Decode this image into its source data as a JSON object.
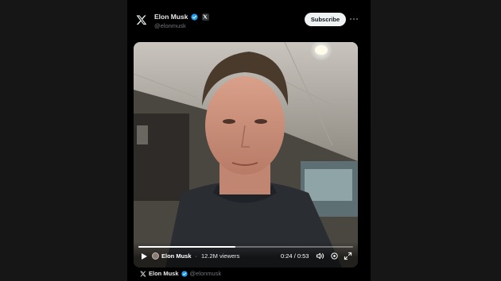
{
  "post": {
    "author_name": "Elon Musk",
    "author_handle": "@elonmusk",
    "subscribe_label": "Subscribe"
  },
  "video": {
    "host_name": "Elon Musk",
    "separator": "·",
    "viewers": "12.2M viewers",
    "elapsed": "0:24",
    "time_separator": " / ",
    "duration": "0:53",
    "progress_fraction": 0.45
  },
  "quote": {
    "author_name": "Elon Musk",
    "author_handle": "@elonmusk"
  },
  "icons": {
    "brand": "x-logo-icon",
    "verified": "verified-badge-icon",
    "more": "more-options-icon",
    "play": "play-icon",
    "volume": "volume-icon",
    "settings": "settings-icon",
    "fullscreen": "fullscreen-icon"
  },
  "colors": {
    "background": "#000000",
    "side_panel": "#161616",
    "verified_blue": "#1d9bf0",
    "subscribe_bg": "#eff3f4",
    "muted_text": "#71767b"
  }
}
